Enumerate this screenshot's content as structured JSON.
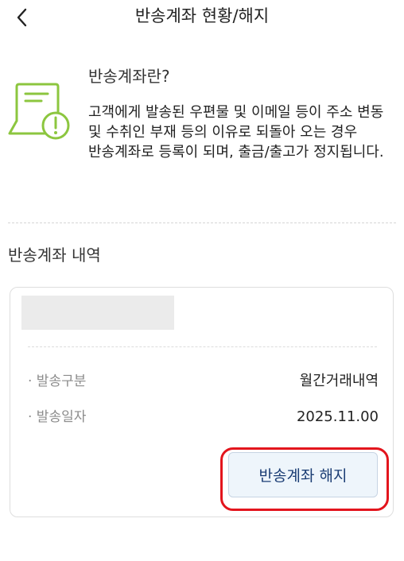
{
  "header": {
    "title": "반송계좌 현황/해지",
    "back_icon": "chevron-left-icon"
  },
  "info": {
    "icon": "monitor-alert-icon",
    "heading": "반송계좌란?",
    "body": "고객에게 발송된 우편물 및 이메일 등이 주소 변동 및 수취인 부재 등의 이유로 되돌아 오는 경우 반송계좌로 등록이 되며, 출금/출고가 정지됩니다."
  },
  "section": {
    "title": "반송계좌 내역"
  },
  "card": {
    "rows": [
      {
        "label": "· 발송구분",
        "value": "월간거래내역"
      },
      {
        "label": "· 발송일자",
        "value": "2025.11.00"
      }
    ],
    "cancel_button_label": "반송계좌 해지"
  },
  "colors": {
    "icon_green": "#8cc63f",
    "highlight_red": "#e3151d",
    "button_text": "#1b3d74",
    "button_bg": "#eef5fb"
  }
}
